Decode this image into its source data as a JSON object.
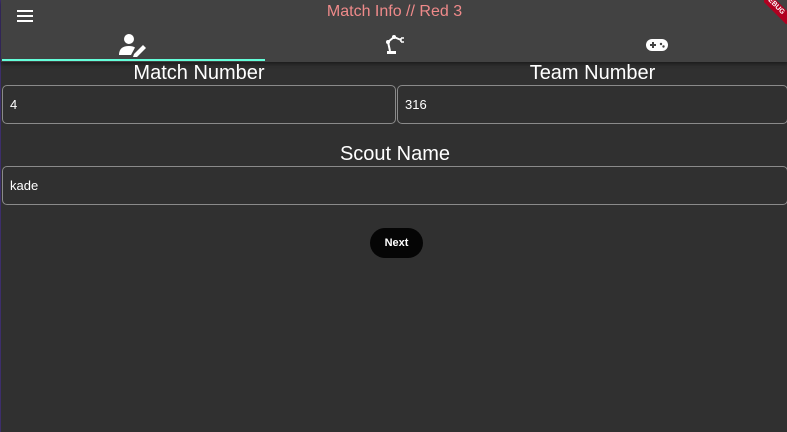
{
  "appbar": {
    "title": "Match Info // Red 3",
    "title_color": "#ef8a8a",
    "menu_icon": "menu-icon",
    "debug_banner": "DEBUG"
  },
  "tabs": [
    {
      "icon": "user-edit-icon",
      "selected": true
    },
    {
      "icon": "robot-arm-icon",
      "selected": false
    },
    {
      "icon": "gamepad-icon",
      "selected": false
    }
  ],
  "colors": {
    "background": "#303030",
    "appbar": "#424242",
    "indicator": "#64ffda",
    "button": "#050505"
  },
  "form": {
    "match_number": {
      "label": "Match Number",
      "value": "4"
    },
    "team_number": {
      "label": "Team Number",
      "value": "316"
    },
    "scout_name": {
      "label": "Scout Name",
      "value": "kade"
    }
  },
  "next_button": {
    "label": "Next"
  }
}
